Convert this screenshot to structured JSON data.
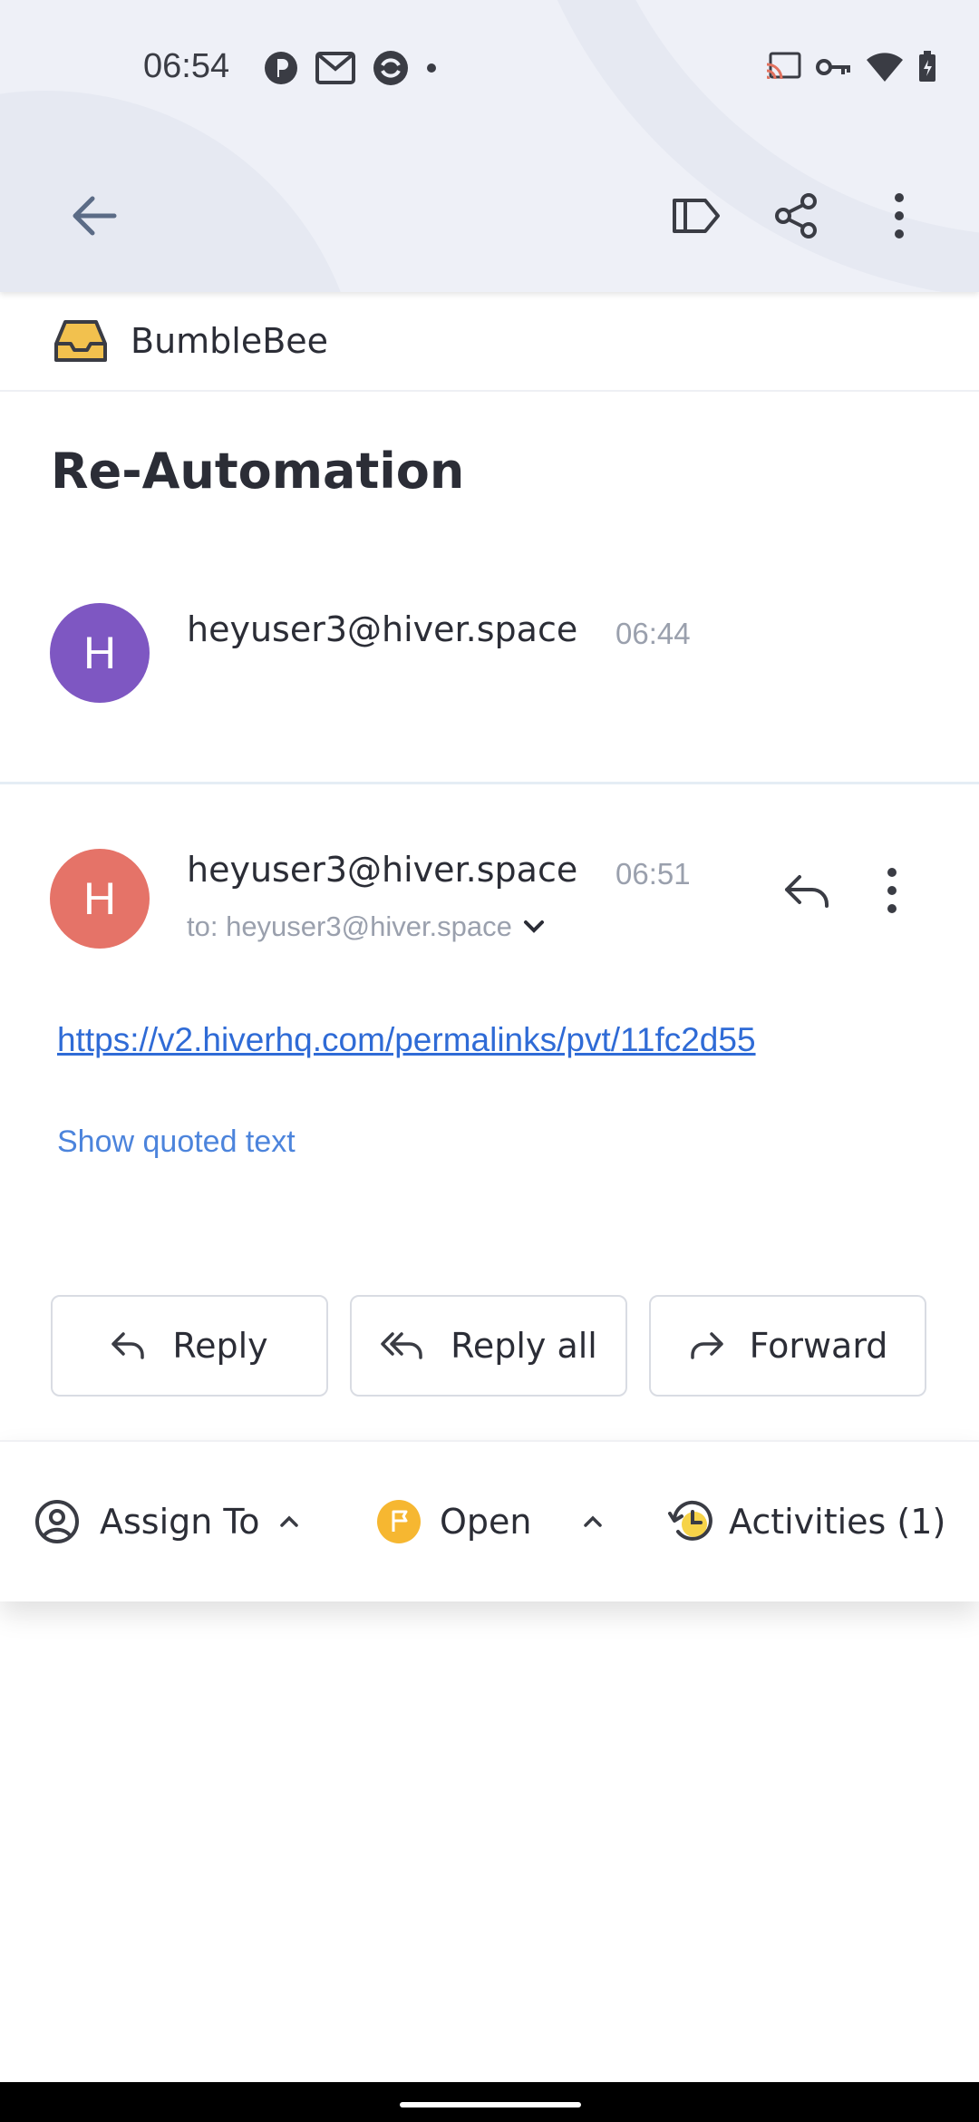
{
  "status_bar": {
    "time": "06:54"
  },
  "inbox": {
    "name": "BumbleBee"
  },
  "conversation": {
    "subject": "Re-Automation"
  },
  "messages": [
    {
      "avatar_letter": "H",
      "avatar_color": "#7e57c2",
      "sender": "heyuser3@hiver.space",
      "time": "06:44"
    },
    {
      "avatar_letter": "H",
      "avatar_color": "#e57368",
      "sender": "heyuser3@hiver.space",
      "time": "06:51",
      "to_line": "to: heyuser3@hiver.space",
      "link": "https://v2.hiverhq.com/permalinks/pvt/11fc2d55",
      "show_quoted": "Show quoted text"
    }
  ],
  "actions": {
    "reply": "Reply",
    "reply_all": "Reply all",
    "forward": "Forward"
  },
  "bottom_bar": {
    "assign": "Assign To",
    "status": "Open",
    "activities": "Activities (1)"
  },
  "colors": {
    "accent": "#2f6bd6",
    "status_open": "#f6b731",
    "inbox_icon": "#f2c14e"
  },
  "icons": [
    "back-arrow-icon",
    "label-icon",
    "share-icon",
    "more-vert-icon",
    "inbox-tray-icon",
    "reply-icon",
    "reply-all-icon",
    "forward-icon",
    "user-circle-icon",
    "flag-icon",
    "history-clock-icon",
    "chevron-up-icon",
    "chevron-down-icon"
  ]
}
